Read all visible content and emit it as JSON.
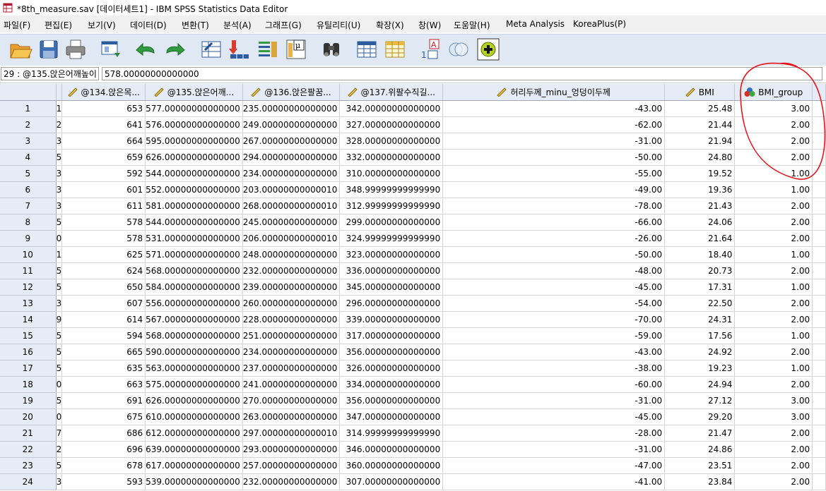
{
  "window": {
    "title": "*8th_measure.sav [데이터세트1] - IBM SPSS Statistics Data Editor"
  },
  "menu": [
    "파일(F)",
    "편집(E)",
    "보기(V)",
    "데이터(D)",
    "변환(T)",
    "분석(A)",
    "그래프(G)",
    "유틸리티(U)",
    "확장(X)",
    "창(W)",
    "도움말(H)",
    "Meta Analysis",
    "KoreaPlus(P)"
  ],
  "toolbar_icons": [
    "open-folder-icon",
    "save-icon",
    "print-icon",
    "dialog-recall-icon",
    "undo-icon",
    "redo-icon",
    "goto-case-icon",
    "goto-variable-icon",
    "variables-icon",
    "run-descriptives-icon",
    "find-icon",
    "split-file-icon",
    "select-cases-icon",
    "value-labels-icon",
    "use-sets-icon",
    "add-icon"
  ],
  "cellbar": {
    "ref": "29 : @135.앉은어깨높이",
    "value": "578.00000000000000"
  },
  "columns": [
    {
      "label": "",
      "type": "partial"
    },
    {
      "label": "@134.앉은목...",
      "type": "scale"
    },
    {
      "label": "@135.앉은어깨...",
      "type": "scale"
    },
    {
      "label": "@136.앉은팔꿈...",
      "type": "scale"
    },
    {
      "label": "@137.위팔수직길...",
      "type": "scale"
    },
    {
      "label": "허리두께_minu_엉덩이두께",
      "type": "scale"
    },
    {
      "label": "BMI",
      "type": "scale"
    },
    {
      "label": "BMI_group",
      "type": "nominal"
    }
  ],
  "rows": [
    {
      "n": "1",
      "c0": "1",
      "c1": "653",
      "c2": "577.00000000000000",
      "c3": "235.00000000000000",
      "c4": "342.00000000000000",
      "c5": "-43.00",
      "c6": "25.48",
      "c7": "3.00"
    },
    {
      "n": "2",
      "c0": "2",
      "c1": "641",
      "c2": "576.00000000000000",
      "c3": "249.00000000000000",
      "c4": "327.00000000000000",
      "c5": "-62.00",
      "c6": "21.44",
      "c7": "2.00"
    },
    {
      "n": "3",
      "c0": "3",
      "c1": "664",
      "c2": "595.00000000000000",
      "c3": "267.00000000000000",
      "c4": "328.00000000000000",
      "c5": "-31.00",
      "c6": "21.94",
      "c7": "2.00"
    },
    {
      "n": "4",
      "c0": "5",
      "c1": "659",
      "c2": "626.00000000000000",
      "c3": "294.00000000000000",
      "c4": "332.00000000000000",
      "c5": "-50.00",
      "c6": "24.80",
      "c7": "2.00"
    },
    {
      "n": "5",
      "c0": "3",
      "c1": "592",
      "c2": "544.00000000000000",
      "c3": "234.00000000000000",
      "c4": "310.00000000000000",
      "c5": "-55.00",
      "c6": "19.52",
      "c7": "1.00"
    },
    {
      "n": "6",
      "c0": "3",
      "c1": "601",
      "c2": "552.00000000000000",
      "c3": "203.00000000000010",
      "c4": "348.99999999999990",
      "c5": "-49.00",
      "c6": "19.36",
      "c7": "1.00"
    },
    {
      "n": "7",
      "c0": "3",
      "c1": "611",
      "c2": "581.00000000000000",
      "c3": "268.00000000000010",
      "c4": "312.99999999999990",
      "c5": "-78.00",
      "c6": "21.43",
      "c7": "2.00"
    },
    {
      "n": "8",
      "c0": "5",
      "c1": "578",
      "c2": "544.00000000000000",
      "c3": "245.00000000000000",
      "c4": "299.00000000000000",
      "c5": "-66.00",
      "c6": "24.06",
      "c7": "2.00"
    },
    {
      "n": "9",
      "c0": "0",
      "c1": "578",
      "c2": "531.00000000000000",
      "c3": "206.00000000000010",
      "c4": "324.99999999999990",
      "c5": "-26.00",
      "c6": "21.64",
      "c7": "2.00"
    },
    {
      "n": "10",
      "c0": "1",
      "c1": "625",
      "c2": "571.00000000000000",
      "c3": "248.00000000000000",
      "c4": "323.00000000000000",
      "c5": "-50.00",
      "c6": "18.40",
      "c7": "1.00"
    },
    {
      "n": "11",
      "c0": "5",
      "c1": "624",
      "c2": "568.00000000000000",
      "c3": "232.00000000000000",
      "c4": "336.00000000000000",
      "c5": "-48.00",
      "c6": "20.73",
      "c7": "2.00"
    },
    {
      "n": "12",
      "c0": "5",
      "c1": "650",
      "c2": "584.00000000000000",
      "c3": "239.00000000000000",
      "c4": "345.00000000000000",
      "c5": "-45.00",
      "c6": "17.31",
      "c7": "1.00"
    },
    {
      "n": "13",
      "c0": "3",
      "c1": "607",
      "c2": "556.00000000000000",
      "c3": "260.00000000000000",
      "c4": "296.00000000000000",
      "c5": "-54.00",
      "c6": "22.50",
      "c7": "2.00"
    },
    {
      "n": "14",
      "c0": "9",
      "c1": "614",
      "c2": "567.00000000000000",
      "c3": "228.00000000000000",
      "c4": "339.00000000000000",
      "c5": "-70.00",
      "c6": "24.31",
      "c7": "2.00"
    },
    {
      "n": "15",
      "c0": "5",
      "c1": "594",
      "c2": "568.00000000000000",
      "c3": "251.00000000000000",
      "c4": "317.00000000000000",
      "c5": "-59.00",
      "c6": "17.56",
      "c7": "1.00"
    },
    {
      "n": "16",
      "c0": "5",
      "c1": "665",
      "c2": "590.00000000000000",
      "c3": "234.00000000000000",
      "c4": "356.00000000000000",
      "c5": "-43.00",
      "c6": "24.92",
      "c7": "2.00"
    },
    {
      "n": "17",
      "c0": "5",
      "c1": "635",
      "c2": "563.00000000000000",
      "c3": "237.00000000000000",
      "c4": "326.00000000000000",
      "c5": "-38.00",
      "c6": "19.23",
      "c7": "1.00"
    },
    {
      "n": "18",
      "c0": "0",
      "c1": "663",
      "c2": "575.00000000000000",
      "c3": "241.00000000000000",
      "c4": "334.00000000000000",
      "c5": "-60.00",
      "c6": "24.94",
      "c7": "2.00"
    },
    {
      "n": "19",
      "c0": "5",
      "c1": "691",
      "c2": "626.00000000000000",
      "c3": "270.00000000000000",
      "c4": "356.00000000000000",
      "c5": "-31.00",
      "c6": "27.12",
      "c7": "3.00"
    },
    {
      "n": "20",
      "c0": "0",
      "c1": "675",
      "c2": "610.00000000000000",
      "c3": "263.00000000000000",
      "c4": "347.00000000000000",
      "c5": "-45.00",
      "c6": "29.20",
      "c7": "3.00"
    },
    {
      "n": "21",
      "c0": "7",
      "c1": "686",
      "c2": "612.00000000000000",
      "c3": "297.00000000000010",
      "c4": "314.99999999999990",
      "c5": "-28.00",
      "c6": "21.47",
      "c7": "2.00"
    },
    {
      "n": "22",
      "c0": "2",
      "c1": "696",
      "c2": "639.00000000000000",
      "c3": "293.00000000000000",
      "c4": "346.00000000000000",
      "c5": "-31.00",
      "c6": "24.86",
      "c7": "2.00"
    },
    {
      "n": "23",
      "c0": "5",
      "c1": "678",
      "c2": "617.00000000000000",
      "c3": "257.00000000000000",
      "c4": "360.00000000000000",
      "c5": "-47.00",
      "c6": "23.51",
      "c7": "2.00"
    },
    {
      "n": "24",
      "c0": "3",
      "c1": "593",
      "c2": "539.00000000000000",
      "c3": "232.00000000000000",
      "c4": "307.00000000000000",
      "c5": "-41.00",
      "c6": "23.84",
      "c7": "2.00"
    }
  ],
  "annotation": {
    "color": "#e8141b"
  }
}
